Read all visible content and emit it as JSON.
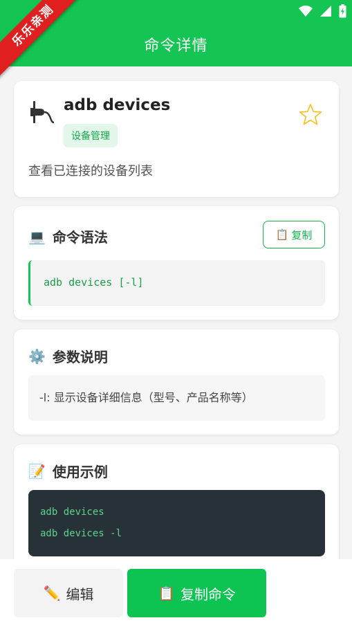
{
  "ribbon": {
    "text": "乐乐亲测"
  },
  "appbar": {
    "title": "命令详情"
  },
  "command": {
    "name": "adb devices",
    "category": "设备管理",
    "description": "查看已连接的设备列表",
    "favorite": false
  },
  "syntax": {
    "title": "命令语法",
    "icon": "💻",
    "copy_label": "复制",
    "copy_icon": "📋",
    "code": "adb devices [-l]"
  },
  "params": {
    "title": "参数说明",
    "icon": "⚙️",
    "text": "-l: 显示设备详细信息（型号、产品名称等）"
  },
  "examples": {
    "title": "使用示例",
    "icon": "📝",
    "lines": [
      "adb devices",
      "adb devices -l"
    ]
  },
  "bottom": {
    "edit_icon": "✏️",
    "edit_label": "编辑",
    "copy_icon": "📋",
    "copy_label": "复制命令"
  },
  "colors": {
    "primary": "#15c553",
    "ribbon": "#e02020",
    "star": "#f4c430"
  }
}
